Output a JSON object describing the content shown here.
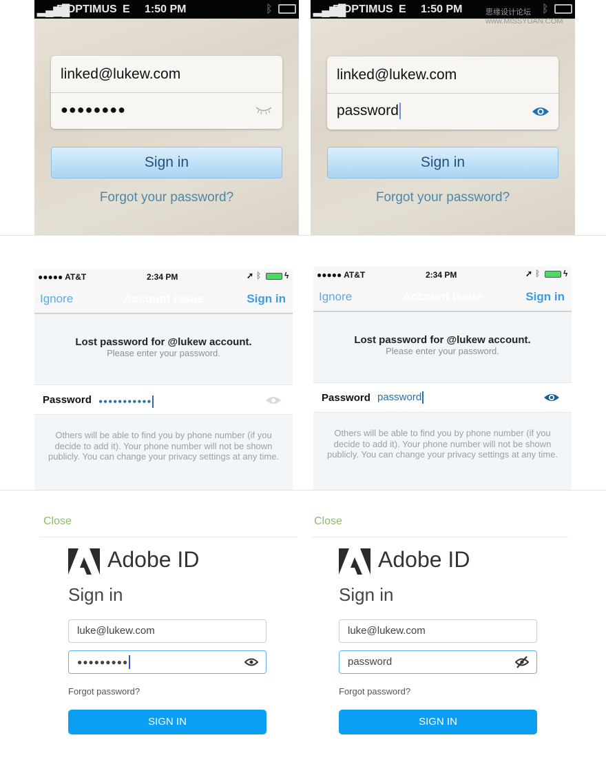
{
  "watermark": "思缘设计论坛 www.MISSYUAN.COM",
  "row1": {
    "carrier": "P OPTIMUS",
    "network": "E",
    "time": "1:50 PM",
    "email": "linked@lukew.com",
    "masked_password": "●●●●●●●●",
    "revealed_password": "password",
    "sign_in": "Sign in",
    "forgot": "Forgot your password?",
    "hidden_icon": "closed-eye-icon",
    "shown_icon": "eye-icon"
  },
  "row2": {
    "carrier": "●●●●● AT&T",
    "time_left": "2:34 PM",
    "time_right": "2:34 PM",
    "ignore": "Ignore",
    "title": "Account issue",
    "sign_in": "Sign in",
    "heading": "Lost password for @lukew account.",
    "subheading": "Please enter your password.",
    "password_label": "Password",
    "masked_password": "●●●●●●●●●●●",
    "revealed_password": "password",
    "info": "Others will be able to find you by phone number (if you decide to add it). Your phone number will not be shown publicly. You can change your privacy settings at any time.",
    "accent": "#3d9be5"
  },
  "row3": {
    "close": "Close",
    "brand": "Adobe ID",
    "heading": "Sign in",
    "email": "luke@lukew.com",
    "masked_password": "●●●●●●●●●",
    "revealed_password": "password",
    "forgot": "Forgot password?",
    "sign_in": "SIGN IN",
    "accent": "#0c9ef2"
  }
}
